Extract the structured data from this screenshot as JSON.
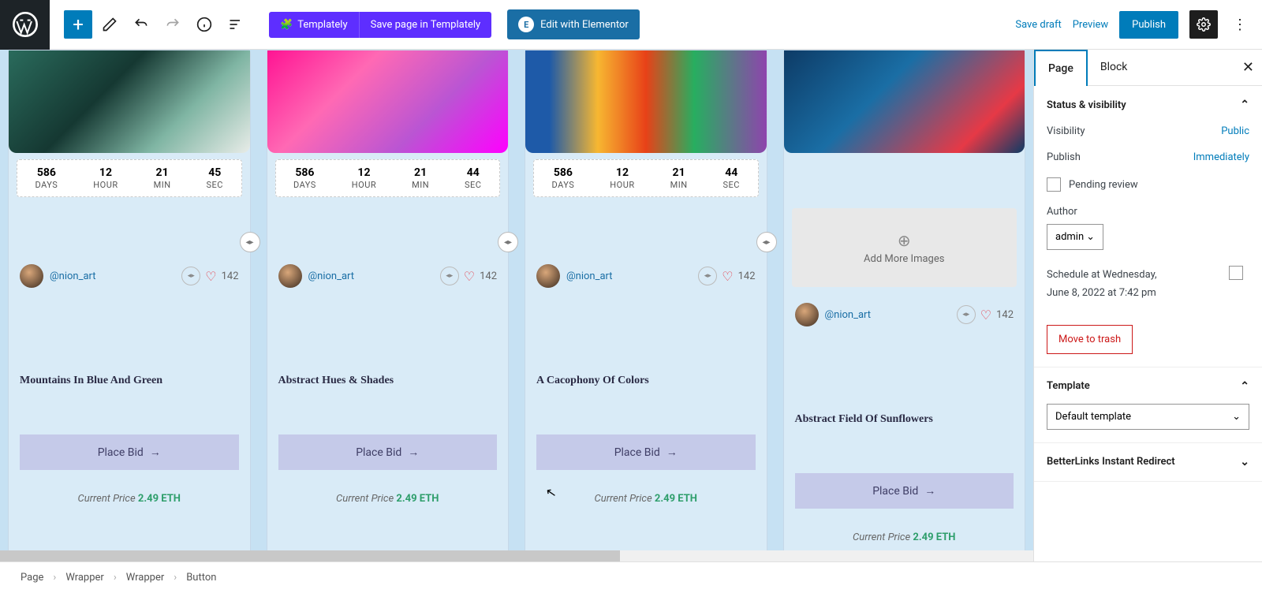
{
  "toolbar": {
    "templately_label": "Templately",
    "save_templately_label": "Save page in Templately",
    "edit_elementor_label": "Edit with Elementor",
    "save_draft_label": "Save draft",
    "preview_label": "Preview",
    "publish_label": "Publish"
  },
  "cards": [
    {
      "timer": {
        "days": "586",
        "hour": "12",
        "min": "21",
        "sec": "45"
      },
      "handle": "@nion_art",
      "likes": "142",
      "title": "Mountains In Blue And Green",
      "bid": "Place Bid",
      "price_label": "Current Price ",
      "price_value": "2.49 ETH"
    },
    {
      "timer": {
        "days": "586",
        "hour": "12",
        "min": "21",
        "sec": "44"
      },
      "handle": "@nion_art",
      "likes": "142",
      "title": "Abstract Hues & Shades",
      "bid": "Place Bid",
      "price_label": "Current Price ",
      "price_value": "2.49 ETH"
    },
    {
      "timer": {
        "days": "586",
        "hour": "12",
        "min": "21",
        "sec": "44"
      },
      "handle": "@nion_art",
      "likes": "142",
      "title": "A Cacophony Of Colors",
      "bid": "Place Bid",
      "price_label": "Current Price ",
      "price_value": "2.49 ETH"
    },
    {
      "addmore": "Add More Images",
      "handle": "@nion_art",
      "likes": "142",
      "title": "Abstract Field Of Sunflowers",
      "bid": "Place Bid",
      "price_label": "Current Price ",
      "price_value": "2.49 ETH"
    }
  ],
  "timer_labels": {
    "days": "DAYS",
    "hour": "HOUR",
    "min": "MIN",
    "sec": "SEC"
  },
  "sidebar": {
    "tab_page": "Page",
    "tab_block": "Block",
    "status_h": "Status & visibility",
    "visibility_l": "Visibility",
    "visibility_v": "Public",
    "publish_l": "Publish",
    "publish_v": "Immediately",
    "pending": "Pending review",
    "author_l": "Author",
    "author_v": "admin",
    "schedule_l": "Schedule at",
    "schedule_day": "Wednesday,",
    "schedule_date": "June 8, 2022 at 7:42 pm",
    "trash": "Move to trash",
    "template_h": "Template",
    "template_v": "Default template",
    "betterlinks_h": "BetterLinks Instant Redirect"
  },
  "breadcrumb": [
    "Page",
    "Wrapper",
    "Wrapper",
    "Button"
  ]
}
